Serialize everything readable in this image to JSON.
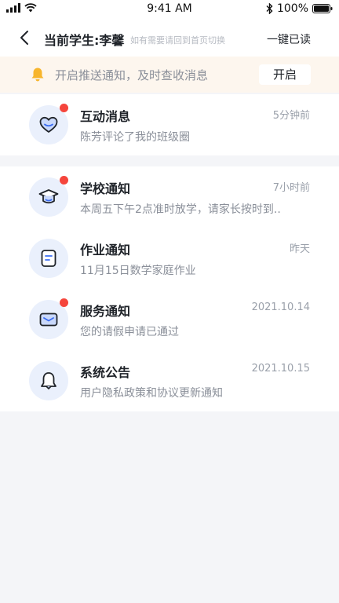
{
  "status_bar": {
    "time": "9:41 AM",
    "battery": "100%"
  },
  "nav": {
    "title": "当前学生:李馨",
    "hint": "如有需要请回到首页切换",
    "action": "一键已读"
  },
  "banner": {
    "text": "开启推送通知，及时查收消息",
    "button": "开启"
  },
  "messages": [
    {
      "title": "互动消息",
      "time": "5分钟前",
      "preview": "陈芳评论了我的班级圈",
      "icon": "heart-icon",
      "unread": true
    },
    {
      "title": "学校通知",
      "time": "7小时前",
      "preview": "本周五下午2点准时放学，请家长按时到..",
      "icon": "graduation-cap-icon",
      "unread": true
    },
    {
      "title": "作业通知",
      "time": "昨天",
      "preview": "11月15日数学家庭作业",
      "icon": "document-icon",
      "unread": false
    },
    {
      "title": "服务通知",
      "time": "2021.10.14",
      "preview": "您的请假申请已通过",
      "icon": "envelope-icon",
      "unread": true
    },
    {
      "title": "系统公告",
      "time": "2021.10.15",
      "preview": "用户隐私政策和协议更新通知",
      "icon": "bell-icon",
      "unread": false
    }
  ],
  "colors": {
    "accent_blue": "#3b6df2",
    "icon_bg": "#eaf0fc",
    "unread_dot": "#f5453c",
    "banner_bg": "#fdf6ee",
    "bell": "#f7b52c"
  }
}
